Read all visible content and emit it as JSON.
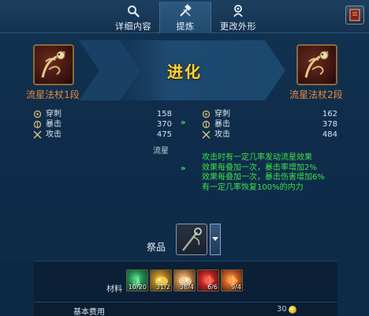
{
  "tabs": [
    {
      "label": "详细内容",
      "icon": "magnifier-icon",
      "active": false
    },
    {
      "label": "提炼",
      "icon": "hammer-icon",
      "active": true
    },
    {
      "label": "更改外形",
      "icon": "reshape-icon",
      "active": false
    }
  ],
  "upgrade": {
    "title": "进化",
    "from_item": "流星法杖1段",
    "to_item": "流星法杖2段"
  },
  "stats_before": [
    {
      "name": "穿刺",
      "value": "158",
      "icon": "pierce-icon"
    },
    {
      "name": "暴击",
      "value": "370",
      "icon": "critical-icon"
    },
    {
      "name": "攻击",
      "value": "475",
      "icon": "crossed-swords-icon"
    }
  ],
  "stats_after": [
    {
      "name": "穿刺",
      "value": "162",
      "icon": "pierce-icon"
    },
    {
      "name": "暴击",
      "value": "378",
      "icon": "critical-icon"
    },
    {
      "name": "攻击",
      "value": "484",
      "icon": "crossed-swords-icon"
    }
  ],
  "arrow_glyph": "»",
  "series_label": "流星",
  "effect_lines": [
    "攻击时有一定几率发动流星效果",
    "效果每叠加一次，暴击率增加2%",
    "效果每叠加一次，暴击伤害增加6%",
    "有一定几率恢复100%的内力"
  ],
  "sacrifice": {
    "label": "祭品"
  },
  "materials": {
    "label": "材料",
    "items": [
      {
        "count": "10/20",
        "icon": "green-crystal-icon"
      },
      {
        "count": "31/2",
        "icon": "gold-ore-icon"
      },
      {
        "count": "38/4",
        "icon": "pale-ore-icon"
      },
      {
        "count": "6/6",
        "icon": "red-gem-icon"
      },
      {
        "count": "9/4",
        "icon": "orange-gem-icon"
      }
    ]
  },
  "cost": {
    "label": "基本费用",
    "value": "30"
  },
  "colors": {
    "accent_green": "#3fe04a",
    "item_name_orange": "#e8893a",
    "title_gold": "#ffd23a"
  }
}
